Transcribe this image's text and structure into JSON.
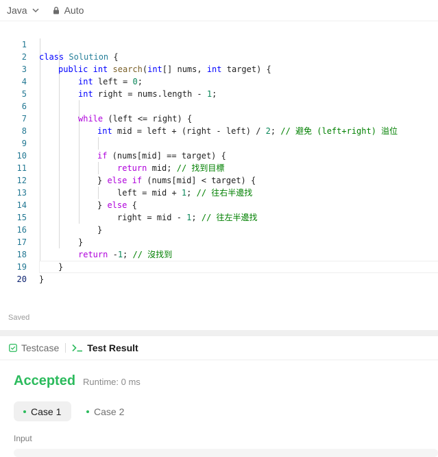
{
  "toolbar": {
    "language": "Java",
    "auto_label": "Auto"
  },
  "editor": {
    "lines": [
      {
        "n": "1"
      },
      {
        "n": "2"
      },
      {
        "n": "3"
      },
      {
        "n": "4"
      },
      {
        "n": "5"
      },
      {
        "n": "6"
      },
      {
        "n": "7"
      },
      {
        "n": "8"
      },
      {
        "n": "9"
      },
      {
        "n": "10"
      },
      {
        "n": "11"
      },
      {
        "n": "12"
      },
      {
        "n": "13"
      },
      {
        "n": "14"
      },
      {
        "n": "15"
      },
      {
        "n": "16"
      },
      {
        "n": "17"
      },
      {
        "n": "18"
      },
      {
        "n": "19"
      },
      {
        "n": "20"
      }
    ],
    "code": {
      "l1": {
        "kw": "class",
        "cls": "Solution",
        "rest": " {"
      },
      "l2": {
        "kw1": "public",
        "kw2": "int",
        "fn": "search",
        "p1": "(",
        "kw3": "int",
        "p2": "[] nums, ",
        "kw4": "int",
        "p3": " target) {"
      },
      "l3": {
        "kw": "int",
        "rest": " left = ",
        "num": "0",
        "end": ";"
      },
      "l4": {
        "kw": "int",
        "rest": " right = nums.length - ",
        "num": "1",
        "end": ";"
      },
      "l6": {
        "kw": "while",
        "rest": " (left <= right) {"
      },
      "l7": {
        "kw": "int",
        "rest": " mid = left + (right - left) / ",
        "num": "2",
        "end": "; ",
        "cm": "// 避免 (left+right) 溢位"
      },
      "l9": {
        "kw": "if",
        "rest": " (nums[mid] == target) {"
      },
      "l10": {
        "kw": "return",
        "rest": " mid; ",
        "cm": "// 找到目標"
      },
      "l11": {
        "p1": "} ",
        "kw1": "else",
        "sp": " ",
        "kw2": "if",
        "rest": " (nums[mid] < target) {"
      },
      "l12": {
        "rest": "left = mid + ",
        "num": "1",
        "end": "; ",
        "cm": "// 往右半邊找"
      },
      "l13": {
        "p1": "} ",
        "kw": "else",
        "rest": " {"
      },
      "l14": {
        "rest": "right = mid - ",
        "num": "1",
        "end": "; ",
        "cm": "// 往左半邊找"
      },
      "l15": {
        "rest": "}"
      },
      "l16": {
        "rest": "}"
      },
      "l17": {
        "kw": "return",
        "rest": " -",
        "num": "1",
        "end": "; ",
        "cm": "// 沒找到"
      },
      "l18": {
        "rest": "}"
      },
      "l19": {
        "rest": "}"
      }
    }
  },
  "status": {
    "saved": "Saved"
  },
  "panel": {
    "tab_testcase": "Testcase",
    "tab_result": "Test Result",
    "result": "Accepted",
    "runtime": "Runtime: 0 ms",
    "case1": "Case 1",
    "case2": "Case 2",
    "input_label": "Input"
  },
  "colors": {
    "accent_green": "#2cbb5d",
    "keyword_blue": "#0000ff",
    "keyword_purple": "#af00db",
    "comment_green": "#008000",
    "number_green": "#098658"
  },
  "icons": {
    "language_dropdown": "chevron-down-icon",
    "auto": "lock-icon",
    "testcase": "checkbox-icon",
    "test_result": "terminal-icon"
  }
}
